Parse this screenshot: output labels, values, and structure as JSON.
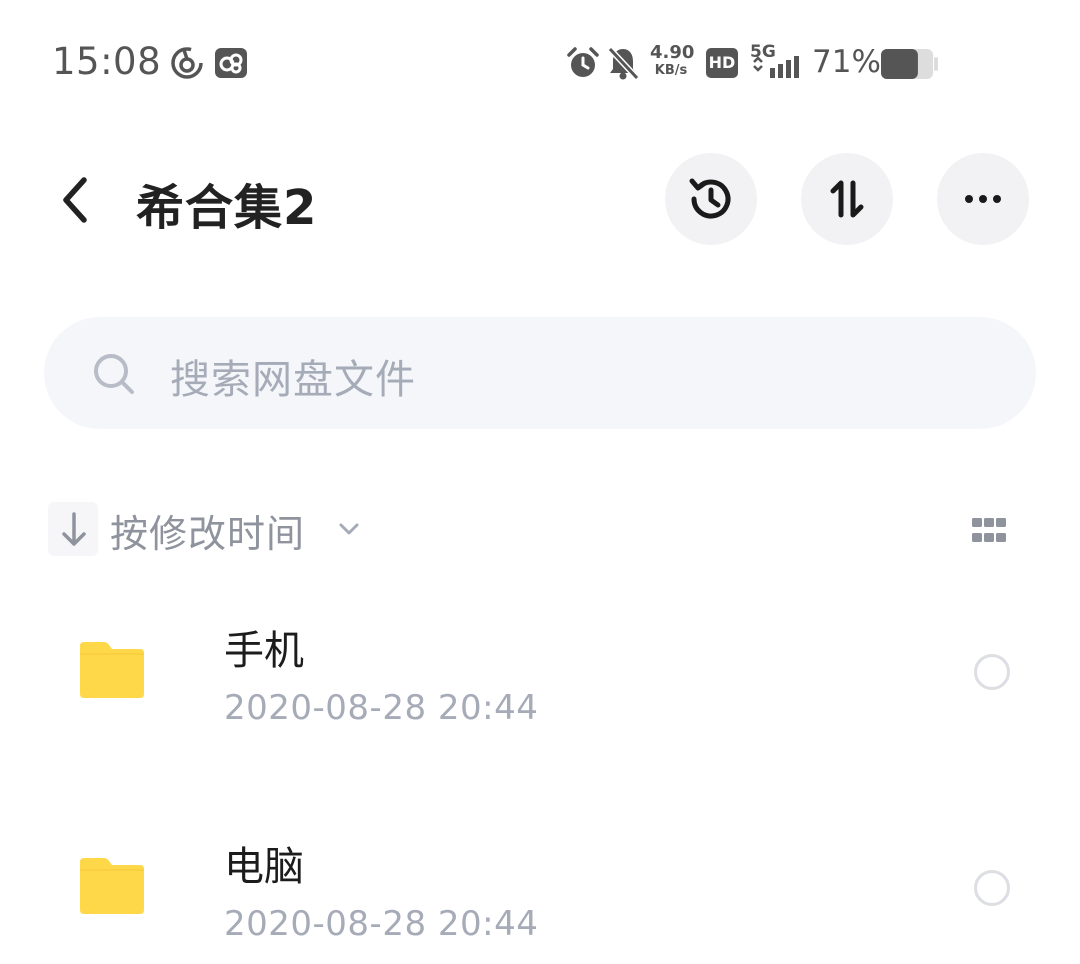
{
  "status_bar": {
    "time": "15:08",
    "net_speed_value": "4.90",
    "net_speed_unit": "KB/s",
    "network_type": "5G",
    "hd_label": "HD",
    "battery_percent": "71%",
    "battery_level": 0.71,
    "left_icons": [
      "netease-music-icon",
      "cloud-sync-app-icon"
    ],
    "right_icons": [
      "alarm-icon",
      "mute-bell-icon",
      "hd-icon",
      "signal-5g-icon",
      "battery-icon"
    ]
  },
  "header": {
    "title": "希合集2",
    "back_icon": "chevron-left-icon",
    "actions": [
      "history-icon",
      "sort-swap-icon",
      "more-dots-icon"
    ]
  },
  "search": {
    "placeholder": "搜索网盘文件",
    "icon": "search-icon"
  },
  "sort": {
    "label": "按修改时间",
    "direction_icon": "arrow-down-icon",
    "dropdown_icon": "chevron-down-icon",
    "view_toggle_icon": "grid-view-icon"
  },
  "files": [
    {
      "name": "手机",
      "modified": "2020-08-28  20:44",
      "type": "folder"
    },
    {
      "name": "电脑",
      "modified": "2020-08-28  20:44",
      "type": "folder"
    }
  ],
  "colors": {
    "folder": "#ffd84a",
    "title": "#222222",
    "secondary_text": "#a6abb8",
    "button_bg": "#f2f2f4",
    "search_bg": "#f4f6fa"
  }
}
